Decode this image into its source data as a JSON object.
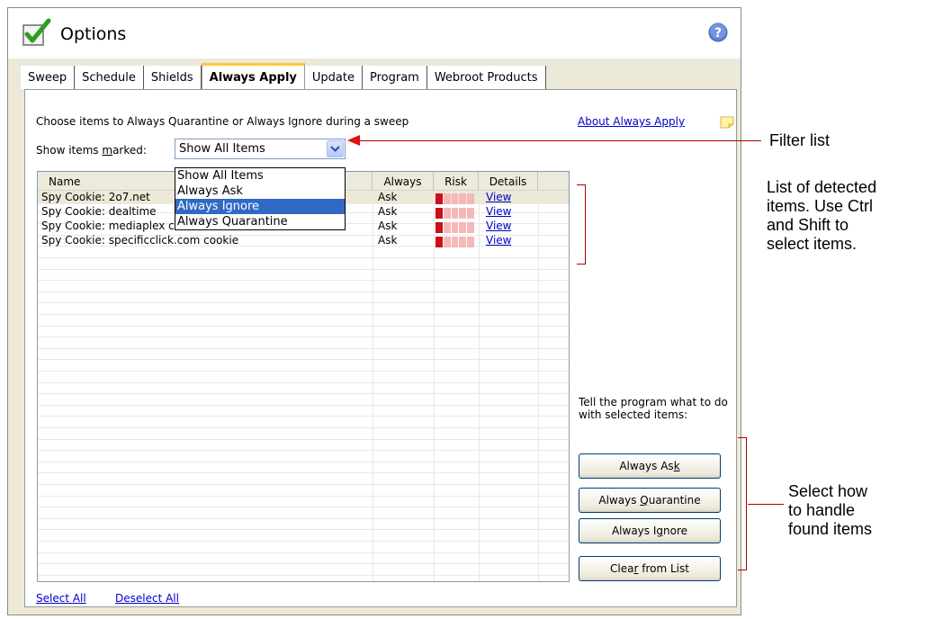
{
  "window": {
    "title": "Options"
  },
  "tabs": [
    {
      "label": "Sweep",
      "active": false
    },
    {
      "label": "Schedule",
      "active": false
    },
    {
      "label": "Shields",
      "active": false
    },
    {
      "label": "Always Apply",
      "active": true
    },
    {
      "label": "Update",
      "active": false
    },
    {
      "label": "Program",
      "active": false
    },
    {
      "label": "Webroot Products",
      "active": false
    }
  ],
  "panel": {
    "description": "Choose items to Always Quarantine or Always Ignore during a sweep",
    "about_link": "About Always Apply",
    "show_label": "Show items marked:",
    "filter": {
      "selected": "Show All Items",
      "options": [
        "Show All Items",
        "Always Ask",
        "Always Ignore",
        "Always Quarantine"
      ],
      "highlighted": "Always Ignore"
    },
    "list": {
      "columns": [
        "Name",
        "Always",
        "Risk",
        "Details"
      ],
      "rows": [
        {
          "name": "Spy Cookie: 2o7.net",
          "always": "Ask",
          "risk": 1,
          "details": "View"
        },
        {
          "name": "Spy Cookie: dealtime",
          "always": "Ask",
          "risk": 1,
          "details": "View"
        },
        {
          "name": "Spy Cookie: mediaplex cookie",
          "always": "Ask",
          "risk": 1,
          "details": "View"
        },
        {
          "name": "Spy Cookie: specificclick.com cookie",
          "always": "Ask",
          "risk": 1,
          "details": "View"
        }
      ]
    },
    "tell_text": "Tell the program what to do with selected items:",
    "buttons": {
      "always_ask": "Always Ask",
      "always_quarantine": "Always Quarantine",
      "always_ignore": "Always Ignore",
      "clear": "Clear from List"
    },
    "select_all": "Select All",
    "deselect_all": "Deselect All"
  },
  "annotations": {
    "filter_list": "Filter list",
    "detected_items": [
      "List of detected",
      "items. Use Ctrl",
      "and Shift to",
      "select items."
    ],
    "handle_items": [
      "Select how",
      "to handle",
      "found items"
    ]
  },
  "colors": {
    "annotation": "#b00000",
    "link": "#0000cc",
    "highlight": "#316ac5",
    "tab_accent": "#ffc83c"
  }
}
